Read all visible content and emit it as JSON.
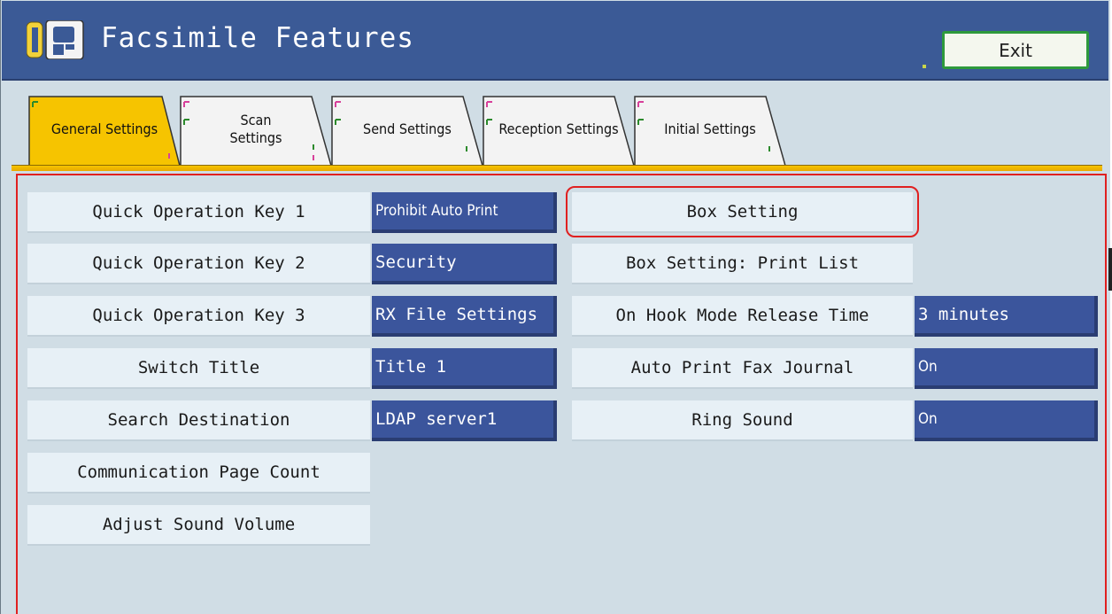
{
  "header": {
    "title": "Facsimile Features",
    "exit_label": "Exit",
    "accent_color": "#3b5a96"
  },
  "tabs": [
    {
      "label": "General Settings",
      "active": true
    },
    {
      "label": "Scan Settings",
      "active": false
    },
    {
      "label": "Send Settings",
      "active": false
    },
    {
      "label": "Reception Settings",
      "active": false
    },
    {
      "label": "Initial Settings",
      "active": false
    }
  ],
  "settings": {
    "left": [
      {
        "label": "Quick Operation Key 1",
        "value": "Prohibit Auto Print"
      },
      {
        "label": "Quick Operation Key 2",
        "value": "Security"
      },
      {
        "label": "Quick Operation Key 3",
        "value": "RX File Settings"
      },
      {
        "label": "Switch Title",
        "value": "Title 1"
      },
      {
        "label": "Search Destination",
        "value": "LDAP server1"
      },
      {
        "label": "Communication Page Count"
      },
      {
        "label": "Adjust Sound Volume"
      }
    ],
    "right": [
      {
        "label": "Box Setting",
        "highlighted": true
      },
      {
        "label": "Box Setting: Print List"
      },
      {
        "label": "On Hook Mode Release Time",
        "value": "3 minutes"
      },
      {
        "label": "Auto Print Fax Journal",
        "value": "On"
      },
      {
        "label": "Ring Sound",
        "value": "On"
      }
    ]
  },
  "colors": {
    "active_tab": "#f6c400",
    "value_button": "#3b559c",
    "label_button": "#e7f0f6",
    "highlight": "#e02020"
  }
}
